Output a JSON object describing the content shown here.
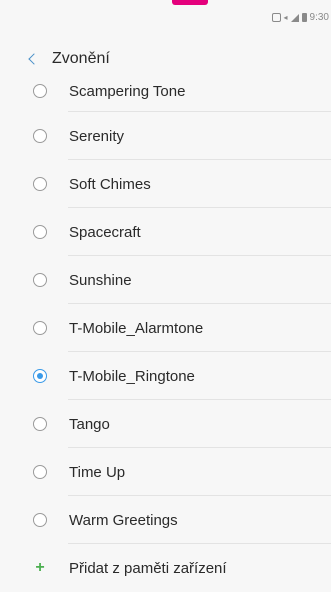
{
  "status_bar": {
    "time": "9:30",
    "icons": [
      "nfc-icon",
      "volume-icon",
      "signal-icon",
      "battery-icon"
    ]
  },
  "header": {
    "back_icon": "chevron-left-icon",
    "title": "Zvonění"
  },
  "ringtones": [
    {
      "label": "Scampering Tone",
      "selected": false
    },
    {
      "label": "Serenity",
      "selected": false
    },
    {
      "label": "Soft Chimes",
      "selected": false
    },
    {
      "label": "Spacecraft",
      "selected": false
    },
    {
      "label": "Sunshine",
      "selected": false
    },
    {
      "label": "T-Mobile_Alarmtone",
      "selected": false
    },
    {
      "label": "T-Mobile_Ringtone",
      "selected": true
    },
    {
      "label": "Tango",
      "selected": false
    },
    {
      "label": "Time Up",
      "selected": false
    },
    {
      "label": "Warm Greetings",
      "selected": false
    }
  ],
  "add_from_device": {
    "icon": "plus-icon",
    "label": "Přidat z paměti zařízení"
  },
  "colors": {
    "accent": "#3a9ae8",
    "add_icon": "#4caf50",
    "top_accent": "#e4007c"
  }
}
